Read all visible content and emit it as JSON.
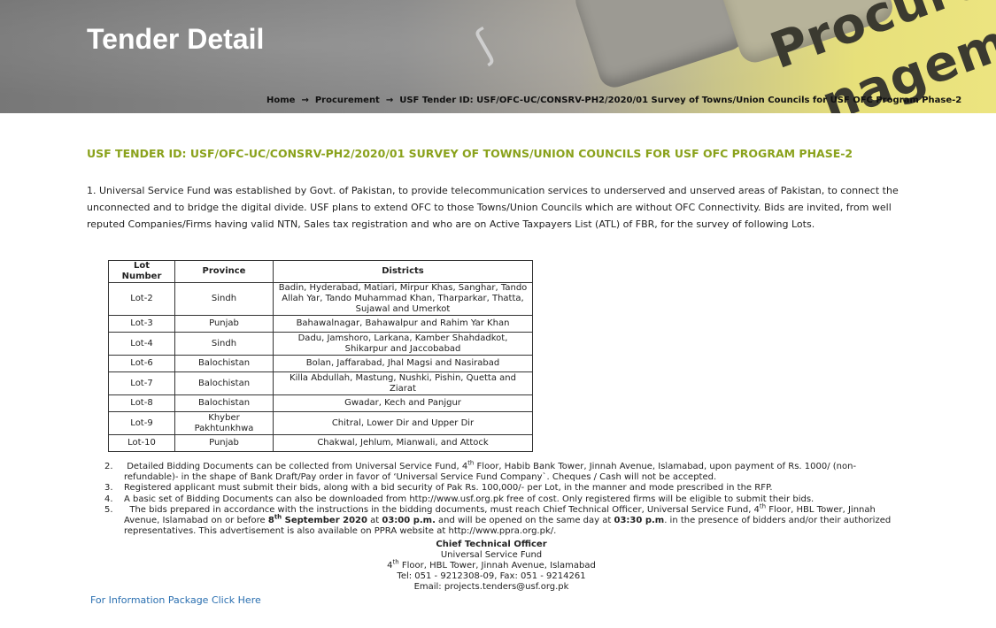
{
  "hero": {
    "title": "Tender Detail",
    "watermark_line1": "Procureme",
    "watermark_line2": "nagem"
  },
  "breadcrumb": {
    "items": [
      "Home",
      "Procurement",
      "USF Tender ID: USF/OFC-UC/CONSRV-PH2/2020/01 Survey of Towns/Union Councils for USF OFC Program Phase-2"
    ],
    "separator": "→"
  },
  "tender": {
    "heading": "USF TENDER ID: USF/OFC-UC/CONSRV-PH2/2020/01 SURVEY OF TOWNS/UNION COUNCILS FOR USF OFC PROGRAM PHASE-2",
    "intro": "1.    Universal Service Fund was established by Govt. of Pakistan, to provide telecommunication services to underserved and unserved areas of Pakistan, to connect the unconnected and to bridge the digital divide. USF plans to extend OFC to those Towns/Union Councils which are without OFC Connectivity. Bids are invited, from well reputed Companies/Firms having valid NTN, Sales tax registration and who are on Active Taxpayers List (ATL) of FBR, for the survey of following Lots."
  },
  "lots_table": {
    "headers": [
      "Lot Number",
      "Province",
      "Districts"
    ],
    "rows": [
      {
        "lot": "Lot-2",
        "province": "Sindh",
        "districts": "Badin, Hyderabad, Matiari, Mirpur Khas, Sanghar, Tando Allah Yar, Tando Muhammad Khan, Tharparkar, Thatta, Sujawal and Umerkot"
      },
      {
        "lot": "Lot-3",
        "province": "Punjab",
        "districts": "Bahawalnagar, Bahawalpur and Rahim Yar Khan"
      },
      {
        "lot": "Lot-4",
        "province": "Sindh",
        "districts": "Dadu, Jamshoro, Larkana, Kamber Shahdadkot, Shikarpur and Jaccobabad"
      },
      {
        "lot": "Lot-6",
        "province": "Balochistan",
        "districts": "Bolan, Jaffarabad, Jhal Magsi and Nasirabad"
      },
      {
        "lot": "Lot-7",
        "province": "Balochistan",
        "districts": "Killa Abdullah, Mastung, Nushki, Pishin, Quetta and Ziarat"
      },
      {
        "lot": "Lot-8",
        "province": "Balochistan",
        "districts": "Gwadar, Kech and Panjgur"
      },
      {
        "lot": "Lot-9",
        "province": "Khyber Pakhtunkhwa",
        "districts": "Chitral, Lower Dir and Upper Dir"
      },
      {
        "lot": "Lot-10",
        "province": "Punjab",
        "districts": "Chakwal, Jehlum, Mianwali, and Attock"
      }
    ]
  },
  "points": {
    "p2_num": "2.",
    "p2_a": "Detailed Bidding Documents can be collected from Universal Service Fund, 4",
    "p2_sup": "th",
    "p2_b": " Floor, Habib Bank Tower, Jinnah Avenue, Islamabad, upon payment of Rs. 1000/ (non-refundable)- in the shape of Bank Draft/Pay order in favor of ‘Universal Service Fund Company`. Cheques / Cash will not be accepted.",
    "p3_num": "3.",
    "p3": "Registered applicant must submit their bids, along with a bid security of Pak Rs. 100,000/- per Lot, in the manner and mode prescribed in the RFP.",
    "p4_num": "4.",
    "p4": "A basic set of Bidding Documents can also be downloaded from http://www.usf.org.pk free of cost. Only registered firms will be eligible to submit their bids.",
    "p5_num": "5.",
    "p5_a": "The bids prepared in accordance with the instructions in the bidding documents, must reach Chief Technical Officer, Universal Service Fund, 4",
    "p5_sup1": "th",
    "p5_b": " Floor, HBL Tower, Jinnah Avenue, Islamabad on or before ",
    "p5_date_a": "8",
    "p5_sup2": "th",
    "p5_date_b": " September 2020",
    "p5_c": " at ",
    "p5_time1": "03:00 p.m.",
    "p5_d": " and will be opened on the same day at ",
    "p5_time2": "03:30 p.m",
    "p5_e": ". in the presence of bidders and/or their authorized representatives. This advertisement is also available on PPRA website at http://www.ppra.org.pk/."
  },
  "signature": {
    "title": "Chief Technical Officer",
    "org": "Universal Service Fund",
    "addr_a": "4",
    "addr_sup": "th",
    "addr_b": " Floor, HBL Tower, Jinnah Avenue, Islamabad",
    "tel": "Tel: 051 - 9212308-09, Fax: 051 - 9214261",
    "email": "Email: projects.tenders@usf.org.pk"
  },
  "info_link": "For Information Package Click Here"
}
